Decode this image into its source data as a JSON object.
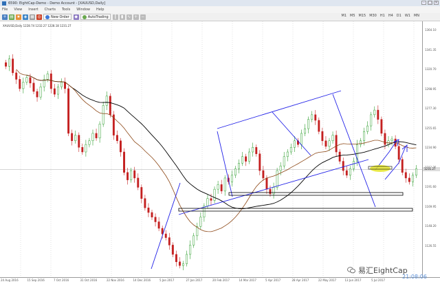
{
  "window": {
    "title": "6590: EightCap-Demo - Demo Account - [XAUUSD,Daily]",
    "controls": [
      "–",
      "□",
      "×"
    ]
  },
  "menu": [
    "File",
    "View",
    "Insert",
    "Charts",
    "Tools",
    "Window",
    "Help"
  ],
  "toolbar": {
    "new_order_label": "New Order",
    "autotrading_label": "AutoTrading",
    "timeframes": [
      "M1",
      "M5",
      "M15",
      "M30",
      "H1",
      "H4",
      "D1",
      "W1",
      "MN"
    ]
  },
  "chart_header": "XAUUSD,Daily  1228.74 1232.27 1228.18 1231.27",
  "price_axis": {
    "ticks": [
      "1364.10",
      "1341.35",
      "1320.70",
      "1298.95",
      "1277.30",
      "1255.65",
      "1234.90",
      "1213.25",
      "1191.60",
      "1169.95",
      "1148.20",
      "1126.55"
    ],
    "current_price": "1231.27"
  },
  "time_axis": {
    "ticks": [
      "24 Aug 2016",
      "15 Sep 2016",
      "7 Oct 2016",
      "31 Oct 2016",
      "22 Nov 2016",
      "14 Dec 2016",
      "5 Jan 2017",
      "27 Jan 2017",
      "20 Feb 2017",
      "14 Mar 2017",
      "5 Apr 2017",
      "28 Apr 2017",
      "22 May 2017",
      "13 Jun 2017",
      "5 Jul 2017"
    ]
  },
  "watermark": {
    "text": "易汇EightCap"
  },
  "clock": "21:08:06",
  "colors": {
    "bull": "#2e9e2e",
    "bear": "#c42020",
    "trend": "#2020e8",
    "ma_fast": "#8b4513",
    "ma_slow": "#000000",
    "highlight": "#e6e62a"
  },
  "chart_data": {
    "type": "candlestick",
    "symbol": "XAUUSD",
    "timeframe": "Daily",
    "ylim": [
      1120,
      1380
    ],
    "series": [
      {
        "name": "close",
        "values": [
          1342,
          1350,
          1335,
          1328,
          1318,
          1325,
          1330,
          1324,
          1315,
          1309,
          1320,
          1328,
          1334,
          1318,
          1312,
          1320,
          1325,
          1318,
          1270,
          1262,
          1268,
          1255,
          1250,
          1258,
          1262,
          1270,
          1265,
          1280,
          1300,
          1310,
          1290,
          1268,
          1262,
          1250,
          1228,
          1220,
          1230,
          1222,
          1212,
          1200,
          1190,
          1185,
          1180,
          1175,
          1168,
          1162,
          1158,
          1150,
          1140,
          1132,
          1128,
          1130,
          1140,
          1150,
          1160,
          1170,
          1180,
          1192,
          1200,
          1198,
          1210,
          1215,
          1208,
          1222,
          1218,
          1225,
          1232,
          1238,
          1245,
          1240,
          1250,
          1255,
          1248,
          1230,
          1222,
          1210,
          1205,
          1212,
          1230,
          1235,
          1245,
          1250,
          1255,
          1262,
          1258,
          1270,
          1275,
          1285,
          1290,
          1284,
          1272,
          1262,
          1256,
          1262,
          1268,
          1250,
          1240,
          1230,
          1225,
          1232,
          1240,
          1258,
          1262,
          1272,
          1278,
          1290,
          1295,
          1285,
          1270,
          1258,
          1262,
          1264,
          1256,
          1242,
          1228,
          1222,
          1218,
          1225,
          1232
        ]
      }
    ]
  }
}
